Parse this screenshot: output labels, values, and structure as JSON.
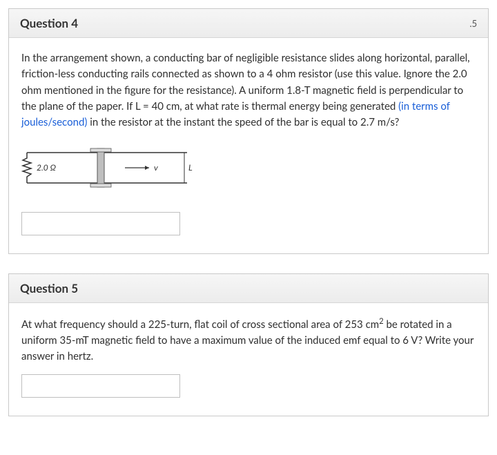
{
  "questions": [
    {
      "title": "Question 4",
      "points": ".5",
      "body_parts": [
        {
          "text": "In the arrangement shown, a conducting bar of negligible resistance slides along horizontal, parallel, friction-less conducting rails connected as shown to a 4 ohm resistor (use this value. Ignore the 2.0 ohm mentioned in the figure for the resistance). A uniform 1.8-T magnetic field is perpendicular to the plane of the paper. If L = 40 cm, at what rate is thermal energy being generated "
        },
        {
          "text": "(in terms of joules/second)",
          "class": "hint"
        },
        {
          "text": " in the resistor at the instant the speed of the bar is equal to 2.7 m/s?"
        }
      ],
      "figure": {
        "resistor_label": "2.0 Ω",
        "velocity_label": "v",
        "length_label": "L"
      },
      "answer_placeholder": ""
    },
    {
      "title": "Question 5",
      "points": "",
      "body_parts": [
        {
          "text": "At what frequency should a 225-turn, flat coil of cross sectional area of 253 cm"
        },
        {
          "text": "2",
          "sup": true
        },
        {
          "text": " be rotated in a uniform 35-mT magnetic field to have a maximum value of the induced emf equal to 6 V? Write your answer in hertz."
        }
      ],
      "answer_placeholder": ""
    }
  ]
}
